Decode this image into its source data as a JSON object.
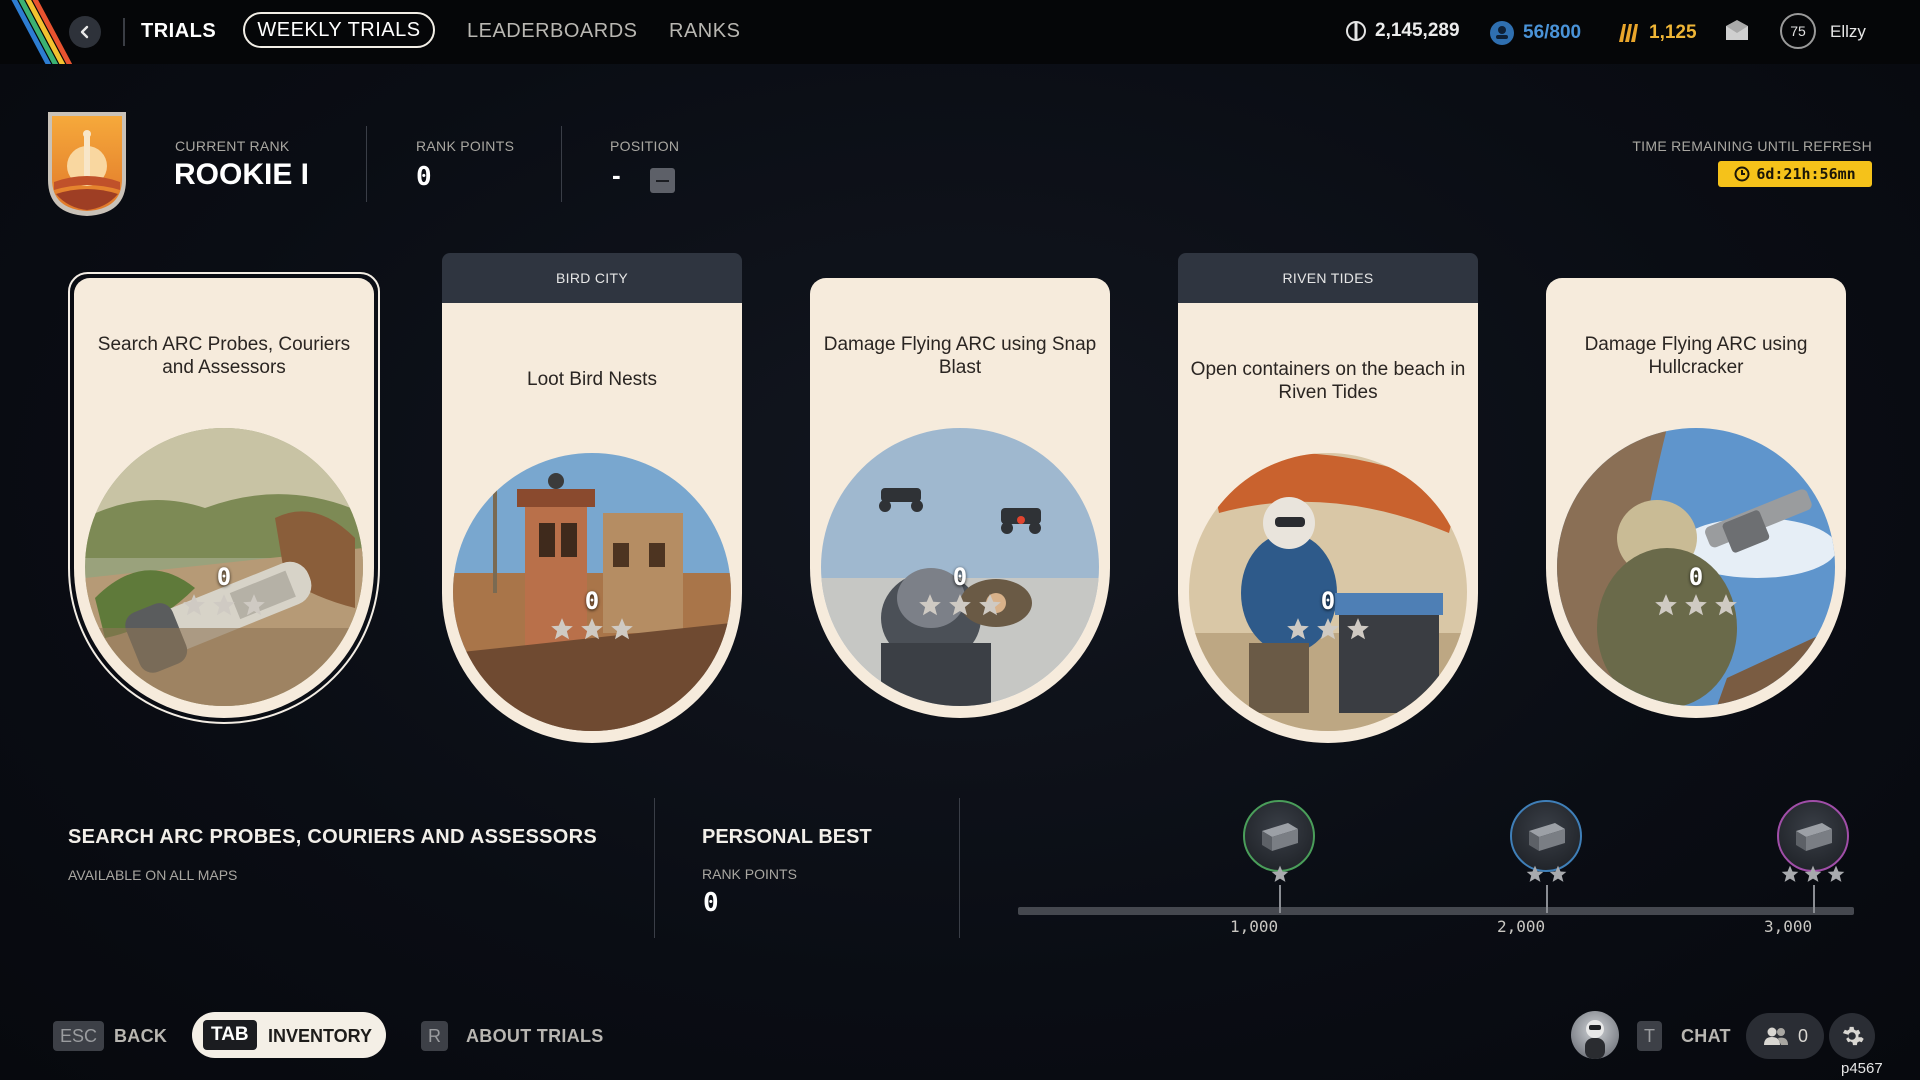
{
  "nav": {
    "tabs": [
      {
        "label": "TRIALS"
      },
      {
        "label": "WEEKLY TRIALS"
      },
      {
        "label": "LEADERBOARDS"
      },
      {
        "label": "RANKS"
      }
    ]
  },
  "currencies": {
    "coins": "2,145,289",
    "blue": "56/800",
    "gold": "1,125"
  },
  "user": {
    "level": "75",
    "name": "Ellzy"
  },
  "rank": {
    "current_label": "CURRENT RANK",
    "current_value": "ROOKIE I",
    "points_label": "RANK POINTS",
    "points_value": "0",
    "position_label": "POSITION",
    "position_value": "-"
  },
  "refresh": {
    "label": "TIME REMAINING UNTIL REFRESH",
    "time": "6d:21h:56mn"
  },
  "cards": [
    {
      "map": "",
      "title": "Search ARC Probes, Couriers and Assessors",
      "score": "0",
      "stars_filled": 0
    },
    {
      "map": "BIRD CITY",
      "title": "Loot Bird Nests",
      "score": "0",
      "stars_filled": 0
    },
    {
      "map": "",
      "title": "Damage Flying ARC using Snap Blast",
      "score": "0",
      "stars_filled": 0
    },
    {
      "map": "RIVEN TIDES",
      "title": "Open containers on the beach in Riven Tides",
      "score": "0",
      "stars_filled": 0
    },
    {
      "map": "",
      "title": "Damage Flying ARC using Hullcracker",
      "score": "0",
      "stars_filled": 0
    }
  ],
  "selected_trial": {
    "title": "SEARCH ARC PROBES, COURIERS AND ASSESSORS",
    "subtitle": "AVAILABLE ON ALL MAPS"
  },
  "personal_best": {
    "title": "PERSONAL BEST",
    "points_label": "RANK POINTS",
    "points_value": "0"
  },
  "milestones": [
    {
      "label": "1,000",
      "stars": 1,
      "color": "#4a9e5a"
    },
    {
      "label": "2,000",
      "stars": 2,
      "color": "#3f7fb8"
    },
    {
      "label": "3,000",
      "stars": 3,
      "color": "#a04ea8"
    }
  ],
  "footer": {
    "esc_key": "ESC",
    "back_label": "BACK",
    "tab_key": "TAB",
    "inventory_label": "INVENTORY",
    "r_key": "R",
    "about_label": "ABOUT TRIALS",
    "t_key": "T",
    "chat_label": "CHAT",
    "friends_count": "0",
    "build_id": "p4567"
  },
  "colors": {
    "accent_yellow": "#f5c21a",
    "card_bg": "#f6ebdc",
    "tab_bg": "#2f3540"
  }
}
